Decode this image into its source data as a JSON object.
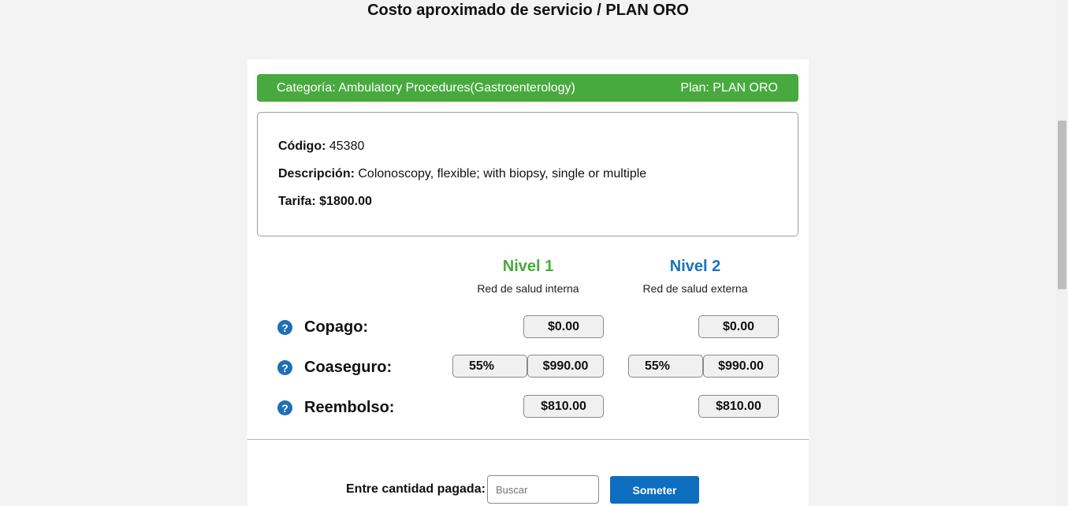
{
  "page": {
    "title": "Costo aproximado de servicio / PLAN ORO"
  },
  "category_bar": {
    "category_label": "Categoría: Ambulatory Procedures(Gastroenterology)",
    "plan_label": "Plan: PLAN ORO",
    "color": "#48aa3e"
  },
  "service": {
    "code_label": "Código:",
    "code_value": "45380",
    "description_label": "Descripción:",
    "description_value": "Colonoscopy, flexible; with biopsy, single or multiple",
    "rate_label": "Tarifa: $1800.00"
  },
  "levels": [
    {
      "title": "Nivel 1",
      "subtitle": "Red de salud interna",
      "color": "#48aa3e"
    },
    {
      "title": "Nivel 2",
      "subtitle": "Red de salud externa",
      "color": "#1773bf"
    }
  ],
  "rows": {
    "copago": {
      "label": "Copago:",
      "nivel1": "$0.00",
      "nivel2": "$0.00"
    },
    "coaseguro": {
      "label": "Coaseguro:",
      "nivel1_percent": "55%",
      "nivel1_amount": "$990.00",
      "nivel2_percent": "55%",
      "nivel2_amount": "$990.00"
    },
    "reembolso": {
      "label": "Reembolso:",
      "nivel1": "$810.00",
      "nivel2": "$810.00"
    }
  },
  "help_icon": "question-circle-icon",
  "payment": {
    "label": "Entre cantidad pagada:",
    "input_placeholder": "Buscar",
    "submit_label": "Someter",
    "submit_color": "#0d6ebf"
  }
}
